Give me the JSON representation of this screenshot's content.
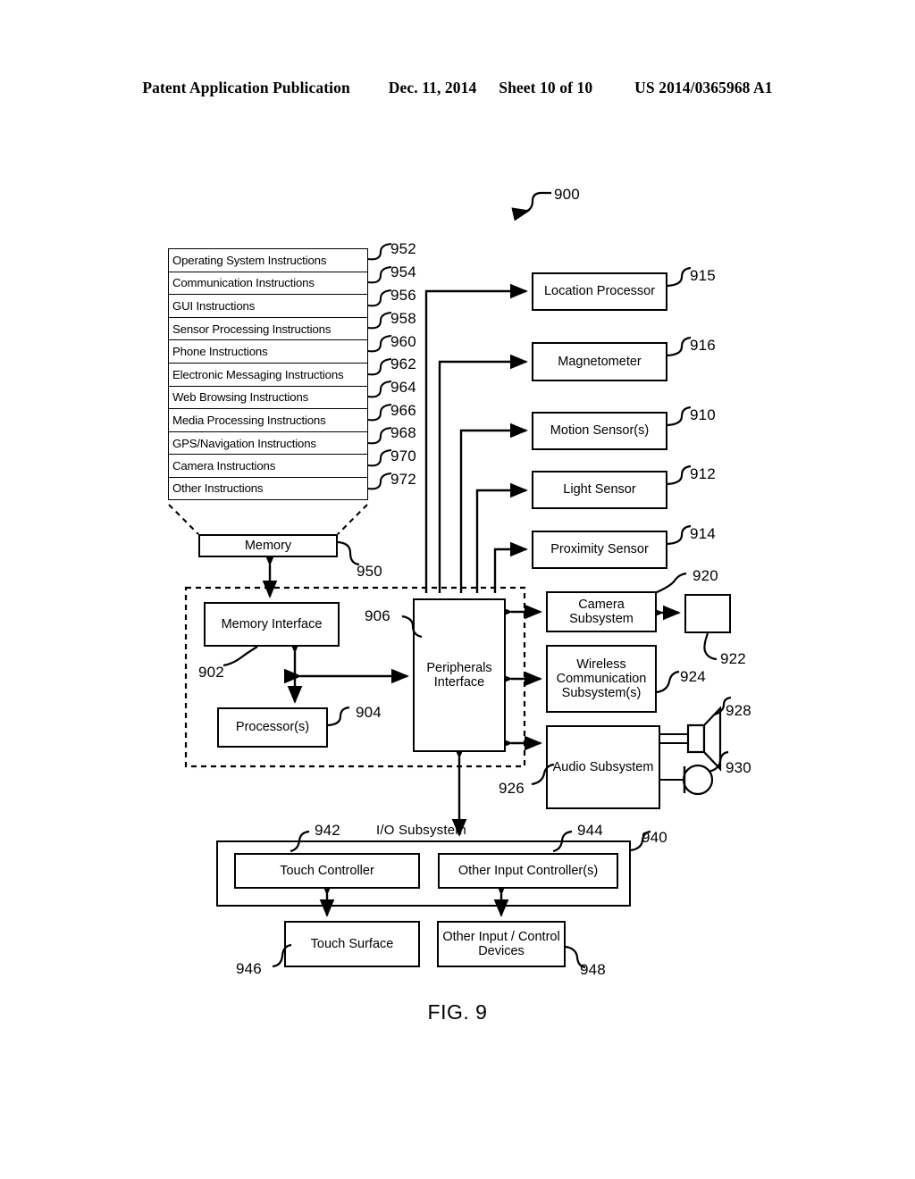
{
  "header": {
    "publication": "Patent Application Publication",
    "date": "Dec. 11, 2014",
    "sheet": "Sheet 10 of 10",
    "number": "US 2014/0365968 A1"
  },
  "figure": {
    "caption": "FIG. 9",
    "system_ref": "900"
  },
  "memory_block": {
    "label": "Memory",
    "ref": "950",
    "instructions": [
      {
        "label": "Operating System Instructions",
        "ref": "952"
      },
      {
        "label": "Communication Instructions",
        "ref": "954"
      },
      {
        "label": "GUI Instructions",
        "ref": "956"
      },
      {
        "label": "Sensor Processing Instructions",
        "ref": "958"
      },
      {
        "label": "Phone Instructions",
        "ref": "960"
      },
      {
        "label": "Electronic Messaging Instructions",
        "ref": "962"
      },
      {
        "label": "Web Browsing Instructions",
        "ref": "964"
      },
      {
        "label": "Media Processing Instructions",
        "ref": "966"
      },
      {
        "label": "GPS/Navigation Instructions",
        "ref": "968"
      },
      {
        "label": "Camera Instructions",
        "ref": "970"
      },
      {
        "label": "Other Instructions",
        "ref": "972"
      }
    ]
  },
  "sensors": [
    {
      "label": "Location Processor",
      "ref": "915"
    },
    {
      "label": "Magnetometer",
      "ref": "916"
    },
    {
      "label": "Motion Sensor(s)",
      "ref": "910"
    },
    {
      "label": "Light Sensor",
      "ref": "912"
    },
    {
      "label": "Proximity Sensor",
      "ref": "914"
    }
  ],
  "core": {
    "memory_interface": {
      "label": "Memory Interface",
      "ref": "902"
    },
    "processors": {
      "label": "Processor(s)",
      "ref": "904"
    },
    "peripherals_interface": {
      "label": "Peripherals Interface",
      "line1": "Peripherals",
      "line2": "Interface",
      "ref": "906"
    },
    "peripherals_bus_ref": "926"
  },
  "subsystems": {
    "camera": {
      "line1": "Camera",
      "line2": "Subsystem",
      "ref": "920"
    },
    "optical_sensor": {
      "label": "",
      "ref": "922"
    },
    "wireless": {
      "line1": "Wireless",
      "line2": "Communication",
      "line3": "Subsystem(s)",
      "ref": "924"
    },
    "audio": {
      "label": "Audio Subsystem",
      "ref": "926"
    },
    "speaker": {
      "ref": "928"
    },
    "microphone": {
      "ref": "930"
    }
  },
  "io_subsystem": {
    "title": "I/O Subsystem",
    "ref": "940",
    "touch_controller": {
      "label": "Touch Controller",
      "ref": "942"
    },
    "other_input_controller": {
      "label": "Other Input Controller(s)",
      "ref": "944"
    },
    "touch_surface": {
      "label": "Touch Surface",
      "ref": "946"
    },
    "other_input_devices": {
      "line1": "Other Input / Control",
      "line2": "Devices",
      "ref": "948"
    }
  }
}
